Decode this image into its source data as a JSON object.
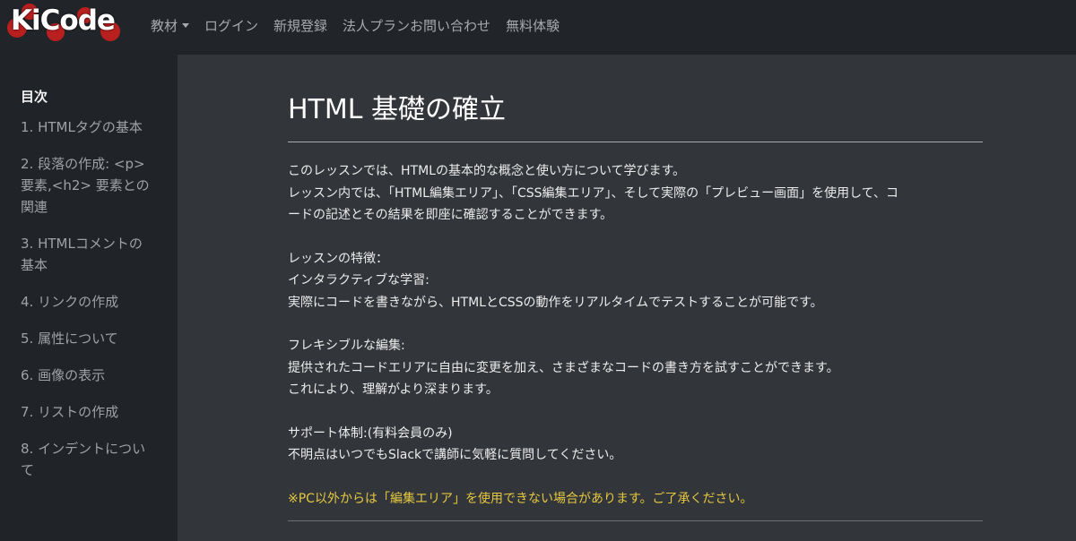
{
  "navbar": {
    "logo_text": "KiCode",
    "items": [
      {
        "label": "教材",
        "has_dropdown": true
      },
      {
        "label": "ログイン"
      },
      {
        "label": "新規登録"
      },
      {
        "label": "法人プランお問い合わせ"
      },
      {
        "label": "無料体験"
      }
    ]
  },
  "sidebar": {
    "title": "目次",
    "items": [
      "1. HTMLタグの基本",
      "2. 段落の作成: <p>要素,<h2> 要素との関連",
      "3. HTMLコメントの基本",
      "4. リンクの作成",
      "5. 属性について",
      "6. 画像の表示",
      "7. リストの作成",
      "8. インデントについて"
    ]
  },
  "lesson": {
    "title": "HTML 基礎の確立",
    "intro_lines": [
      "このレッスンでは、HTMLの基本的な概念と使い方について学びます。",
      "レッスン内では、「HTML編集エリア」、「CSS編集エリア」、そして実際の「プレビュー画面」を使用して、コ",
      "ードの記述とその結果を即座に確認することができます。"
    ],
    "features_lines": [
      "レッスンの特徴：",
      "インタラクティブな学習:",
      "実際にコードを書きながら、HTMLとCSSの動作をリアルタイムでテストすることが可能です。"
    ],
    "flexible_lines": [
      "フレキシブルな編集:",
      "提供されたコードエリアに自由に変更を加え、さまざまなコードの書き方を試すことができます。",
      "これにより、理解がより深まります。"
    ],
    "support_lines": [
      "サポート体制:(有料会員のみ)",
      "不明点はいつでもSlackで講師に気軽に質問してください。"
    ],
    "notice": "※PC以外からは「編集エリア」を使用できない場合があります。ご了承ください。"
  },
  "colors": {
    "accent_logo": "#b81f1f",
    "notice": "#e5c841",
    "main_bg": "#32353a",
    "sidebar_bg": "#202327"
  }
}
